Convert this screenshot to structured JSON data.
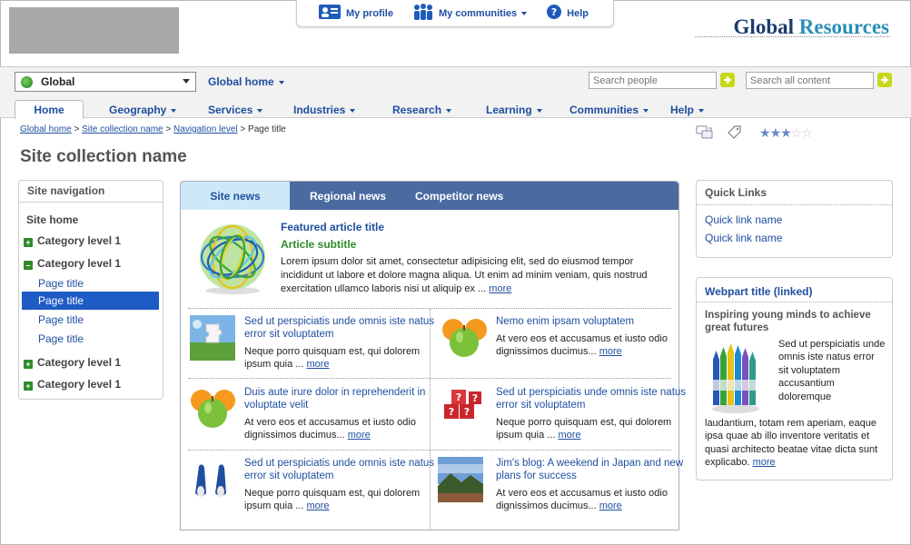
{
  "brand": {
    "word1": "Global",
    "word2": "Resources"
  },
  "topbar": {
    "my_profile": "My profile",
    "my_communities": "My communities",
    "help": "Help"
  },
  "site_selector": {
    "value": "Global"
  },
  "global_home": "Global home",
  "search": {
    "people_placeholder": "Search people",
    "all_placeholder": "Search all content"
  },
  "tabs": [
    "Home",
    "Geography",
    "Services",
    "Industries",
    "Research",
    "Learning",
    "Communities",
    "Help"
  ],
  "breadcrumb": {
    "l1": "Global home",
    "l2": "Site collection name",
    "l3": "Navigation level",
    "current": "Page title",
    "sep": ">"
  },
  "rating": {
    "filled": 3,
    "total": 5
  },
  "page_title": "Site collection name",
  "site_nav": {
    "header": "Site navigation",
    "home": "Site home",
    "cat1": "Category level 1",
    "cat2": "Category level 1",
    "pages": [
      "Page title",
      "Page title",
      "Page title",
      "Page title"
    ],
    "cat3": "Category level 1",
    "cat4": "Category level 1"
  },
  "news_tabs": {
    "site": "Site news",
    "regional": "Regional news",
    "competitor": "Competitor news"
  },
  "featured": {
    "title": "Featured article title",
    "subtitle": "Article subtitle",
    "body": "Lorem ipsum dolor sit amet, consectetur adipisicing elit, sed do eiusmod tempor incididunt ut labore et dolore magna aliqua. Ut enim ad minim veniam, quis nostrud exercitation ullamco laboris nisi ut aliquip ex ...",
    "more": "more"
  },
  "articles": [
    {
      "title": "Sed ut perspiciatis unde omnis iste natus error sit voluptatem",
      "body": "Neque porro quisquam est, qui dolorem ipsum quia ...",
      "more": "more"
    },
    {
      "title": "Nemo enim ipsam voluptatem",
      "body": "At vero eos et accusamus et iusto odio dignissimos ducimus...",
      "more": "more"
    },
    {
      "title": "Duis aute irure dolor in reprehenderit in voluptate velit",
      "body": "At vero eos et accusamus et iusto odio dignissimos ducimus...",
      "more": "more"
    },
    {
      "title": "Sed ut perspiciatis unde omnis iste natus error sit voluptatem",
      "body": "Neque porro quisquam est, qui dolorem ipsum quia ...",
      "more": "more"
    },
    {
      "title": "Sed ut perspiciatis unde omnis iste natus error sit voluptatem",
      "body": "Neque porro quisquam est, qui dolorem ipsum quia ...",
      "more": "more"
    },
    {
      "title": "Jim's blog: A weekend in Japan and new plans for success",
      "body": "At vero eos et accusamus et iusto odio dignissimos ducimus...",
      "more": "more"
    }
  ],
  "quick_links": {
    "header": "Quick Links",
    "links": [
      "Quick link name",
      "Quick link name"
    ]
  },
  "webpart": {
    "title": "Webpart title (linked)",
    "subtitle": "Inspiring young minds to achieve great futures",
    "body1": "Sed ut perspiciatis unde omnis iste natus error sit voluptatem accusantium doloremque",
    "body2": "laudantium, totam rem aperiam, eaque ipsa quae ab illo inventore veritatis et quasi architecto beatae vitae dicta sunt explicabo.",
    "more": "more"
  },
  "colors": {
    "link": "#1f4fa0",
    "nav_selected": "#1e5bc4",
    "green": "#2f8a2a",
    "news_tab_bar": "#4a6aa0",
    "active_tab": "#cfe8f7"
  }
}
